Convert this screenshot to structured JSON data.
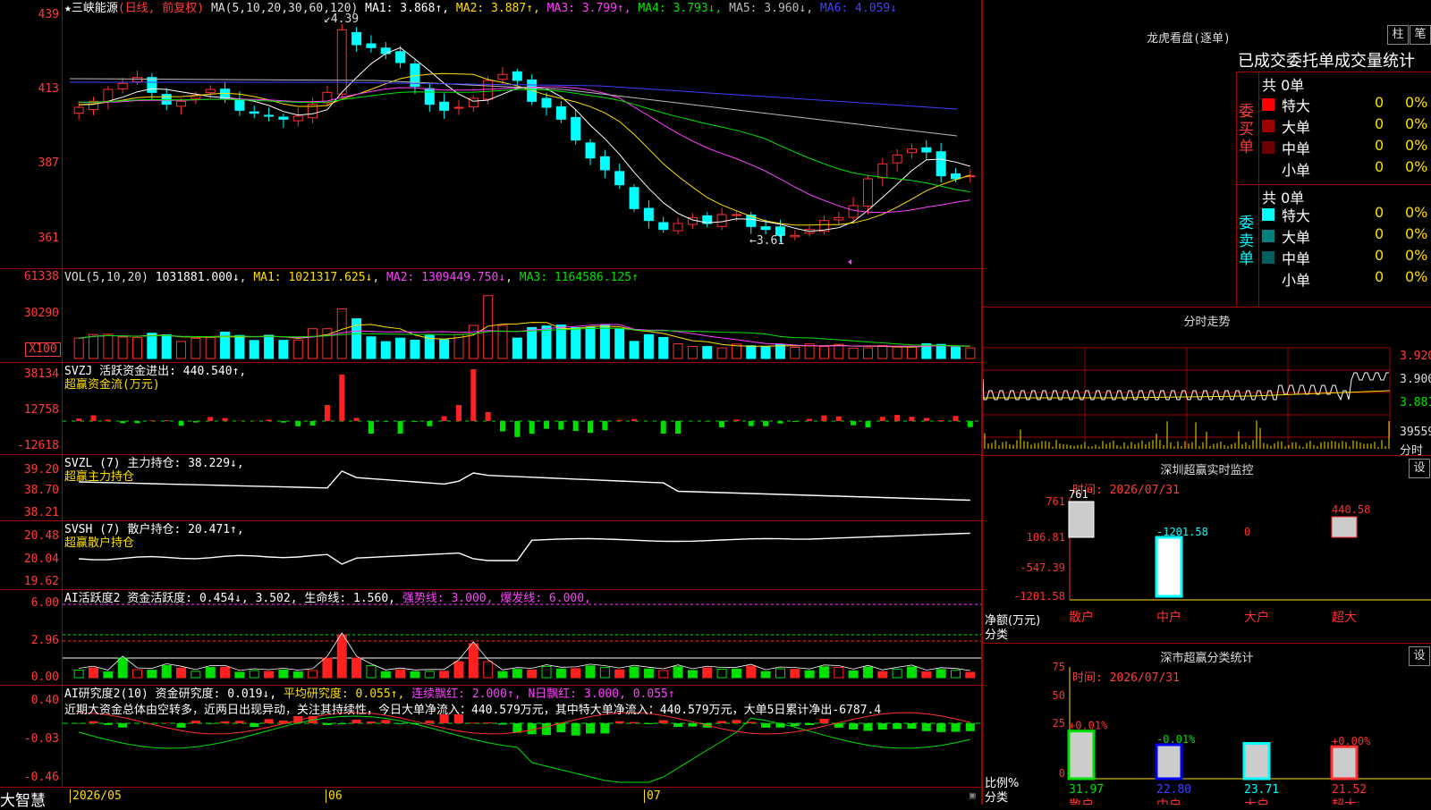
{
  "stock": {
    "name": "★三峡能源",
    "mode": "(日线, 前复权)",
    "ma_label": "MA(5,10,20,30,60,120)",
    "ma": [
      {
        "k": "MA1",
        "v": "3.868↑",
        "c": "#ffffff"
      },
      {
        "k": "MA2",
        "v": "3.887↑",
        "c": "#ffdf00"
      },
      {
        "k": "MA3",
        "v": "3.799↑",
        "c": "#ff40ff"
      },
      {
        "k": "MA4",
        "v": "3.793↓",
        "c": "#00e000"
      },
      {
        "k": "MA5",
        "v": "3.960↓",
        "c": "#bbbbbb"
      },
      {
        "k": "MA6",
        "v": "4.059↓",
        "c": "#4040ff"
      }
    ],
    "hi": "4.39",
    "lo": "3.61"
  },
  "price_axis": [
    "439",
    "413",
    "387",
    "361"
  ],
  "vol": {
    "label": "VOL(5,10,20)",
    "value": "1031881.000↓",
    "ma1": "MA1: 1021317.625↓",
    "ma2": "MA2: 1309449.750↓",
    "ma3": "MA3: 1164586.125↑",
    "axis": [
      "61338",
      "30290"
    ],
    "unit": "X100"
  },
  "svzj": {
    "label": "SVZJ 活跃资金进出: 440.540↑,",
    "sub": "超赢资金流(万元)",
    "axis": [
      "38134",
      "12758",
      "-12618"
    ]
  },
  "svzl": {
    "label": "SVZL (7) 主力持仓: 38.229↓,",
    "sub": "超赢主力持仓",
    "axis": [
      "39.20",
      "38.70",
      "38.21"
    ]
  },
  "svsh": {
    "label": "SVSH (7) 散户持仓: 20.471↑,",
    "sub": "超赢散户持仓",
    "axis": [
      "20.48",
      "20.04",
      "19.62"
    ]
  },
  "ai1": {
    "label": "AI活跃度2 资金活跃度: 0.454↓, 3.502, 生命线: 1.560,",
    "strong": "强势线: 3.000,",
    "burst": "爆发线: 6.000,",
    "axis": [
      "6.00",
      "2.96",
      "0.00"
    ]
  },
  "ai2": {
    "label": "AI研究度2(10) 资金研究度: 0.019↓,",
    "avg": "平均研究度: 0.055↑,",
    "lianxu": "连续飘红: 2.000↑,",
    "nday": "N日飘红: 3.000, 0.055↑",
    "text": "近期大资金总体由空转多，近两日出现异动，关注其持续性，今日大单净流入：440.579万元，其中特大单净流入：440.579万元，大单5日累计净出-6787.4",
    "axis": [
      "0.40",
      "-0.03",
      "-0.46"
    ]
  },
  "dates": [
    "2026/05",
    "06",
    "07"
  ],
  "brand": "大智慧",
  "right": {
    "lhb_title": "龙虎看盘(逐单)",
    "btn_zhu": "柱",
    "btn_bi": "笔",
    "order_title": "已成交委托单成交量统计",
    "buy": {
      "label": "委买单",
      "total": "共 0单",
      "rows": [
        {
          "n": "特大",
          "a": "0",
          "p": "0%",
          "c": "#ff0000"
        },
        {
          "n": "大单",
          "a": "0",
          "p": "0%",
          "c": "#a00000"
        },
        {
          "n": "中单",
          "a": "0",
          "p": "0%",
          "c": "#700000"
        },
        {
          "n": "小单",
          "a": "0",
          "p": "0%",
          "c": "#000000"
        }
      ]
    },
    "sell": {
      "label": "委卖单",
      "total": "共 0单",
      "rows": [
        {
          "n": "特大",
          "a": "0",
          "p": "0%",
          "c": "#00ffff"
        },
        {
          "n": "大单",
          "a": "0",
          "p": "0%",
          "c": "#008080"
        },
        {
          "n": "中单",
          "a": "0",
          "p": "0%",
          "c": "#006060"
        },
        {
          "n": "小单",
          "a": "0",
          "p": "0%",
          "c": "#000000"
        }
      ]
    },
    "fs_title": "分时走势",
    "fs_axis": [
      "3.920",
      "3.900",
      "3.881"
    ],
    "fs_vol": "39559",
    "fs_unit": "分时",
    "mon_title": "深圳超赢实时监控",
    "mon_btn": "设",
    "mon_time": "时间: 2026/07/31",
    "mon_axis": [
      "761",
      "106.81",
      "-547.39",
      "-1201.58"
    ],
    "mon_vals": [
      "761",
      "-1201.58",
      "0",
      "440.58"
    ],
    "mon_cats": [
      "散户",
      "中户",
      "大户",
      "超大"
    ],
    "mon_ylabel": "净额(万元)",
    "mon_xlabel": "分类",
    "cls_title": "深市超赢分类统计",
    "cls_btn": "设",
    "cls_time": "时间: 2026/07/31",
    "cls_axis": [
      "75",
      "50",
      "25",
      "0"
    ],
    "cls_top": [
      "+0.01%",
      "-0.01%",
      "",
      "+0.00%"
    ],
    "cls_vals": [
      "31.97",
      "22.80",
      "23.71",
      "21.52"
    ],
    "cls_cats": [
      "散户",
      "中户",
      "大户",
      "超大"
    ],
    "cls_ylabel": "比例%",
    "cls_xlabel": "分类"
  },
  "chart_data": {
    "type": "candlestick",
    "title": "三峡能源",
    "ylim": [
      3.55,
      4.45
    ],
    "hi": 4.39,
    "lo": 3.61
  }
}
